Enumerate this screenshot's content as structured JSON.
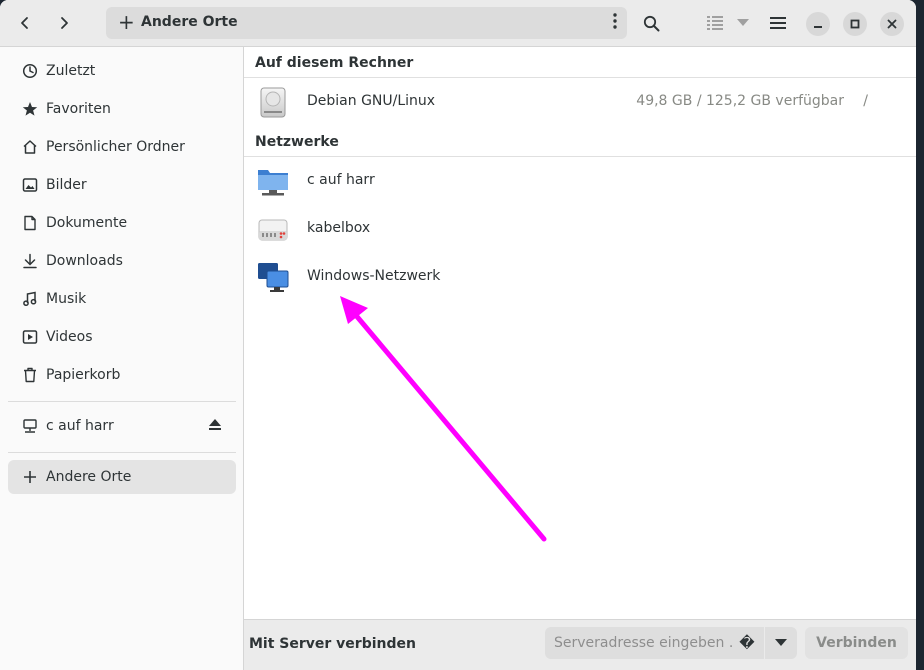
{
  "header": {
    "path_label": "Andere Orte"
  },
  "sidebar": {
    "items": [
      {
        "label": "Zuletzt",
        "icon": "clock-icon"
      },
      {
        "label": "Favoriten",
        "icon": "star-icon"
      },
      {
        "label": "Persönlicher Ordner",
        "icon": "home-icon"
      },
      {
        "label": "Bilder",
        "icon": "image-icon"
      },
      {
        "label": "Dokumente",
        "icon": "document-icon"
      },
      {
        "label": "Downloads",
        "icon": "download-icon"
      },
      {
        "label": "Musik",
        "icon": "music-icon"
      },
      {
        "label": "Videos",
        "icon": "video-icon"
      },
      {
        "label": "Papierkorb",
        "icon": "trash-icon"
      }
    ],
    "mount": {
      "label": "c auf harr",
      "icon": "network-drive-icon"
    },
    "other_places": {
      "label": "Andere Orte",
      "icon": "plus-icon"
    }
  },
  "main": {
    "computer_section": {
      "title": "Auf diesem Rechner",
      "items": [
        {
          "name": "Debian GNU/Linux",
          "info": "49,8 GB / 125,2 GB verfügbar",
          "path": "/",
          "icon": "harddisk-icon"
        }
      ]
    },
    "network_section": {
      "title": "Netzwerke",
      "items": [
        {
          "name": "c auf harr",
          "icon": "network-folder-icon"
        },
        {
          "name": "kabelbox",
          "icon": "network-server-icon"
        },
        {
          "name": "Windows-Netzwerk",
          "icon": "windows-network-icon"
        }
      ]
    }
  },
  "bottom": {
    "label": "Mit Server verbinden",
    "server_placeholder": "Serveradresse eingeben …",
    "help_glyph": "�",
    "connect_label": "Verbinden"
  },
  "colors": {
    "annotation_arrow": "#ff00ff",
    "active_item_bg": "#e4e4e4",
    "folder_blue": "#5d9de3"
  }
}
